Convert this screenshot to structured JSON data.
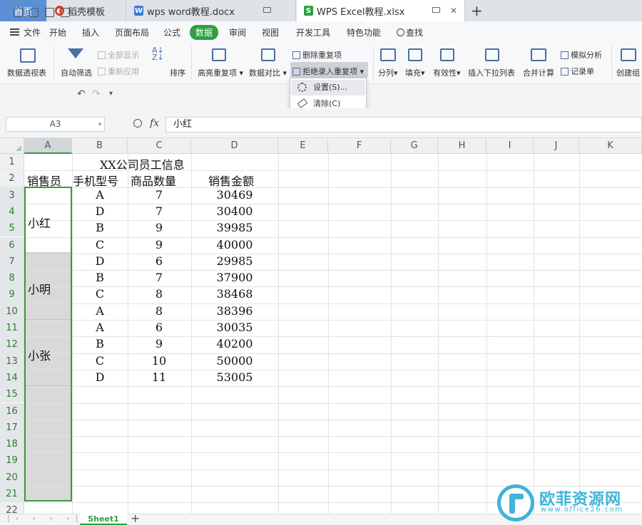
{
  "tabs": {
    "home": "首页",
    "docs": [
      {
        "label": "稻壳模板",
        "icon_color": "#d9381e",
        "icon": "daoke-icon"
      },
      {
        "label": "wps word教程.docx",
        "icon_color": "#3c78d8",
        "icon": "word-doc-icon"
      },
      {
        "label": "WPS Excel教程.xlsx",
        "icon_color": "#2ea043",
        "icon": "excel-doc-icon"
      }
    ],
    "add": "+"
  },
  "menu": {
    "file": "文件",
    "items": [
      "开始",
      "插入",
      "页面布局",
      "公式",
      "数据",
      "审阅",
      "视图",
      "开发工具",
      "特色功能"
    ],
    "active": "数据",
    "search": "查找"
  },
  "ribbon": {
    "pivot": "数据透视表",
    "autofilter": "自动筛选",
    "show_all": "全部显示",
    "reapply": "重新应用",
    "sort": "排序",
    "highlight_dup": "高亮重复项",
    "compare": "数据对比",
    "remove_dup": "删除重复项",
    "reject_dup": "拒绝录入重复项",
    "split": "分列",
    "fill": "填充",
    "validity": "有效性",
    "insert_dropdown": "插入下拉列表",
    "consolidate": "合并计算",
    "simulate": "模拟分析",
    "record_sheet": "记录单",
    "create_group": "创建组"
  },
  "dropdown": {
    "settings": "设置(S)...",
    "clear": "清除(C)"
  },
  "formula_bar": {
    "name_box": "A3",
    "fx": "fx",
    "value": "小红"
  },
  "sheet": {
    "columns": [
      "A",
      "B",
      "C",
      "D",
      "E",
      "F",
      "G",
      "H",
      "I",
      "J",
      "K"
    ],
    "rows": [
      "1",
      "2",
      "3",
      "4",
      "5",
      "6",
      "7",
      "8",
      "9",
      "10",
      "11",
      "12",
      "13",
      "14",
      "15",
      "16",
      "17",
      "18",
      "19",
      "20",
      "21",
      "22"
    ],
    "title": "XX公司员工信息",
    "headers": [
      "销售员",
      "手机型号",
      "商品数量",
      "销售金额"
    ],
    "salespeople": [
      "小红",
      "小明",
      "小张"
    ],
    "data": [
      [
        "A",
        "7",
        "30469"
      ],
      [
        "D",
        "7",
        "30400"
      ],
      [
        "B",
        "9",
        "39985"
      ],
      [
        "C",
        "9",
        "40000"
      ],
      [
        "D",
        "6",
        "29985"
      ],
      [
        "B",
        "7",
        "37900"
      ],
      [
        "C",
        "8",
        "38468"
      ],
      [
        "A",
        "8",
        "38396"
      ],
      [
        "A",
        "6",
        "30035"
      ],
      [
        "B",
        "9",
        "40200"
      ],
      [
        "C",
        "10",
        "50000"
      ],
      [
        "D",
        "11",
        "53005"
      ]
    ],
    "tab_name": "Sheet1",
    "add_sheet": "+"
  },
  "watermark": {
    "text": "欧菲资源网",
    "url": "www.office26.com"
  }
}
